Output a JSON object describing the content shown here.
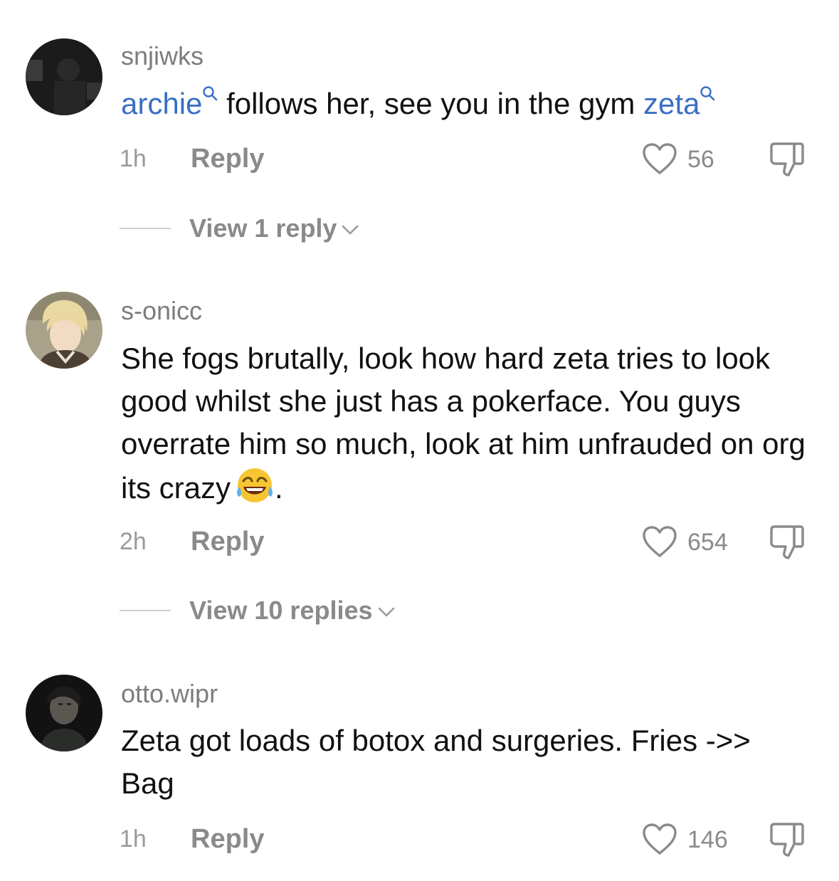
{
  "comments": [
    {
      "username": "snjiwks",
      "text_parts": {
        "mention1": "archie",
        "middle": " follows her, see you in the gym ",
        "mention2": "zeta"
      },
      "time": "1h",
      "reply_label": "Reply",
      "likes": "56",
      "view_replies": "View 1 reply"
    },
    {
      "username": "s-onicc",
      "text": "She fogs brutally, look how hard zeta tries to look good whilst she just has a pokerface. You guys overrate him so much, look at him unfrauded on org its crazy",
      "text_suffix": ".",
      "emoji": "face-with-tears-of-joy",
      "time": "2h",
      "reply_label": "Reply",
      "likes": "654",
      "view_replies": "View 10 replies"
    },
    {
      "username": "otto.wipr",
      "text": "Zeta got loads of botox and surgeries. Fries ->> Bag",
      "time": "1h",
      "reply_label": "Reply",
      "likes": "146"
    }
  ],
  "colors": {
    "mention": "#3a6fc4",
    "meta": "#8a8a8a",
    "text": "#111111"
  },
  "icons": [
    "search-icon",
    "heart-icon",
    "dislike-icon",
    "chevron-down-icon"
  ]
}
